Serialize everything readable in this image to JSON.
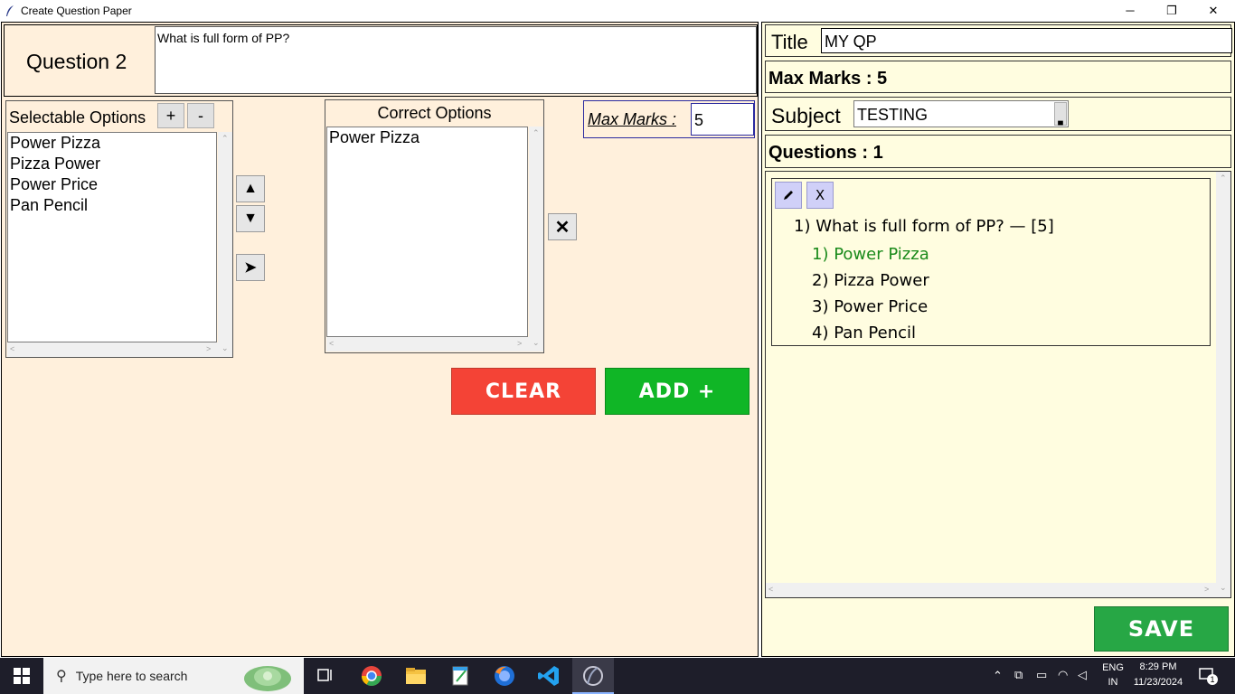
{
  "window": {
    "title": "Create Question Paper",
    "minimize": "─",
    "maximize": "❐",
    "close": "✕"
  },
  "left": {
    "question_label": "Question 2",
    "question_text": "What is full form of PP?",
    "selectable": {
      "title": "Selectable Options",
      "add": "+",
      "remove": "-",
      "items": [
        "Power Pizza",
        "Pizza Power",
        "Power Price",
        "Pan Pencil"
      ]
    },
    "move_up": "▲",
    "move_down": "▼",
    "move_right": "➤",
    "correct": {
      "title": "Correct Options",
      "items": [
        "Power Pizza"
      ]
    },
    "clear_correct": "✕",
    "max_marks": {
      "label": "Max Marks :",
      "value": "5"
    },
    "clear_button": "CLEAR",
    "add_button": "ADD +"
  },
  "right": {
    "title_label": "Title",
    "title_value": "MY QP",
    "max_marks": "Max Marks : 5",
    "subject_label": "Subject",
    "subject_value": "TESTING",
    "questions_count": "Questions : 1",
    "question_card": {
      "edit": "✎",
      "delete": "X",
      "question": "1) What is full form of PP? — [5]",
      "options": [
        "1) Power Pizza",
        "2) Pizza Power",
        "3) Power Price",
        "4) Pan Pencil"
      ],
      "correct_color": "#1a8a1a"
    },
    "save_button": "SAVE"
  },
  "taskbar": {
    "search_placeholder": "Type here to search",
    "lang_top": "ENG",
    "lang_bottom": "IN",
    "time": "8:29 PM",
    "date": "11/23/2024",
    "notification_count": "1"
  },
  "colors": {
    "left_bg": "#fff0dc",
    "right_bg": "#fffde0",
    "clear": "#f44336",
    "add": "#10b626",
    "save": "#27a745"
  }
}
